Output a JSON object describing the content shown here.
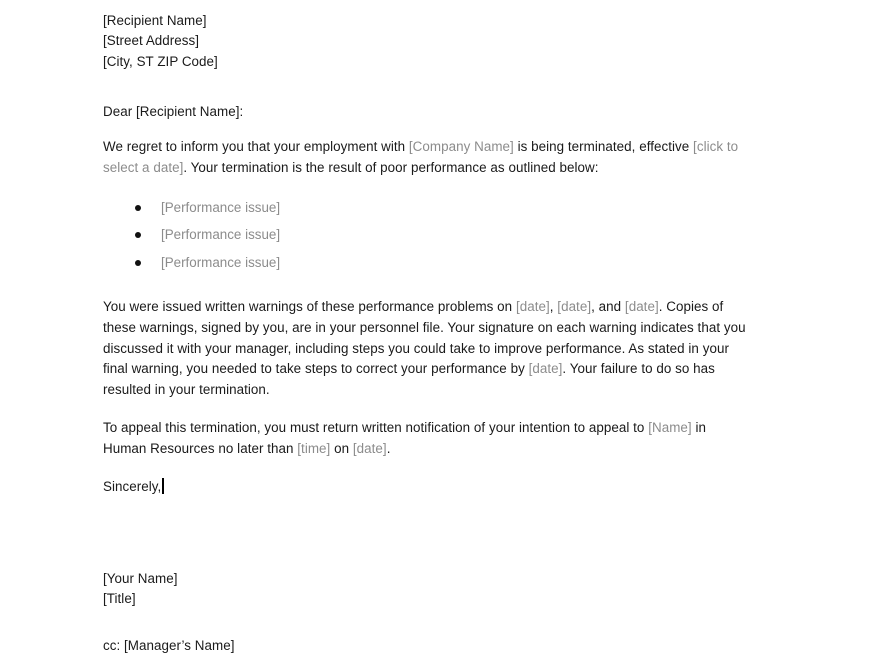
{
  "document": {
    "recipient_block": {
      "name": "[Recipient Name]",
      "street": "[Street Address]",
      "city": "[City, ST ZIP Code]"
    },
    "salutation": "Dear [Recipient Name]:",
    "paragraph1": {
      "line1_a": "We regret to inform you that your employment with ",
      "line1_ph1": "[Company Name]",
      "line1_b": " is being terminated, effective ",
      "line1_ph2": "[click to",
      "line2_ph": "select a date]",
      "line2_b": ". Your termination is the result of poor performance as outlined below:"
    },
    "performance_issues": [
      "[Performance issue]",
      "[Performance issue]",
      "[Performance issue]"
    ],
    "paragraph2": {
      "line1_a": "You were issued written warnings of these performance problems on ",
      "line1_ph1": "[date]",
      "line1_b": ", ",
      "line1_ph2": "[date]",
      "line1_c": ", and ",
      "line1_ph3": "[date]",
      "line1_d": ". Copies of",
      "line2": "these warnings, signed by you, are in your personnel file. Your signature on each warning indicates that you",
      "line3": "discussed it with your manager, including  steps you could take to improve performance. As stated in your",
      "line4_a": "final warning, you needed to take steps to correct your performance by ",
      "line4_ph": "[date]",
      "line4_b": ". Your failure to do so has",
      "line5": "resulted in your termination."
    },
    "paragraph3": {
      "line1_a": "To appeal this termination, you must return written notification of your intention to appeal to ",
      "line1_ph": "[Name]",
      "line1_b": " in",
      "line2_a": "Human Resources no later than ",
      "line2_ph1": "[time]",
      "line2_b": " on ",
      "line2_ph2": "[date]",
      "line2_c": "."
    },
    "closing": "Sincerely,",
    "signature": {
      "name": "[Your Name]",
      "title": "[Title]"
    },
    "cc": "cc: [Manager’s Name]"
  }
}
